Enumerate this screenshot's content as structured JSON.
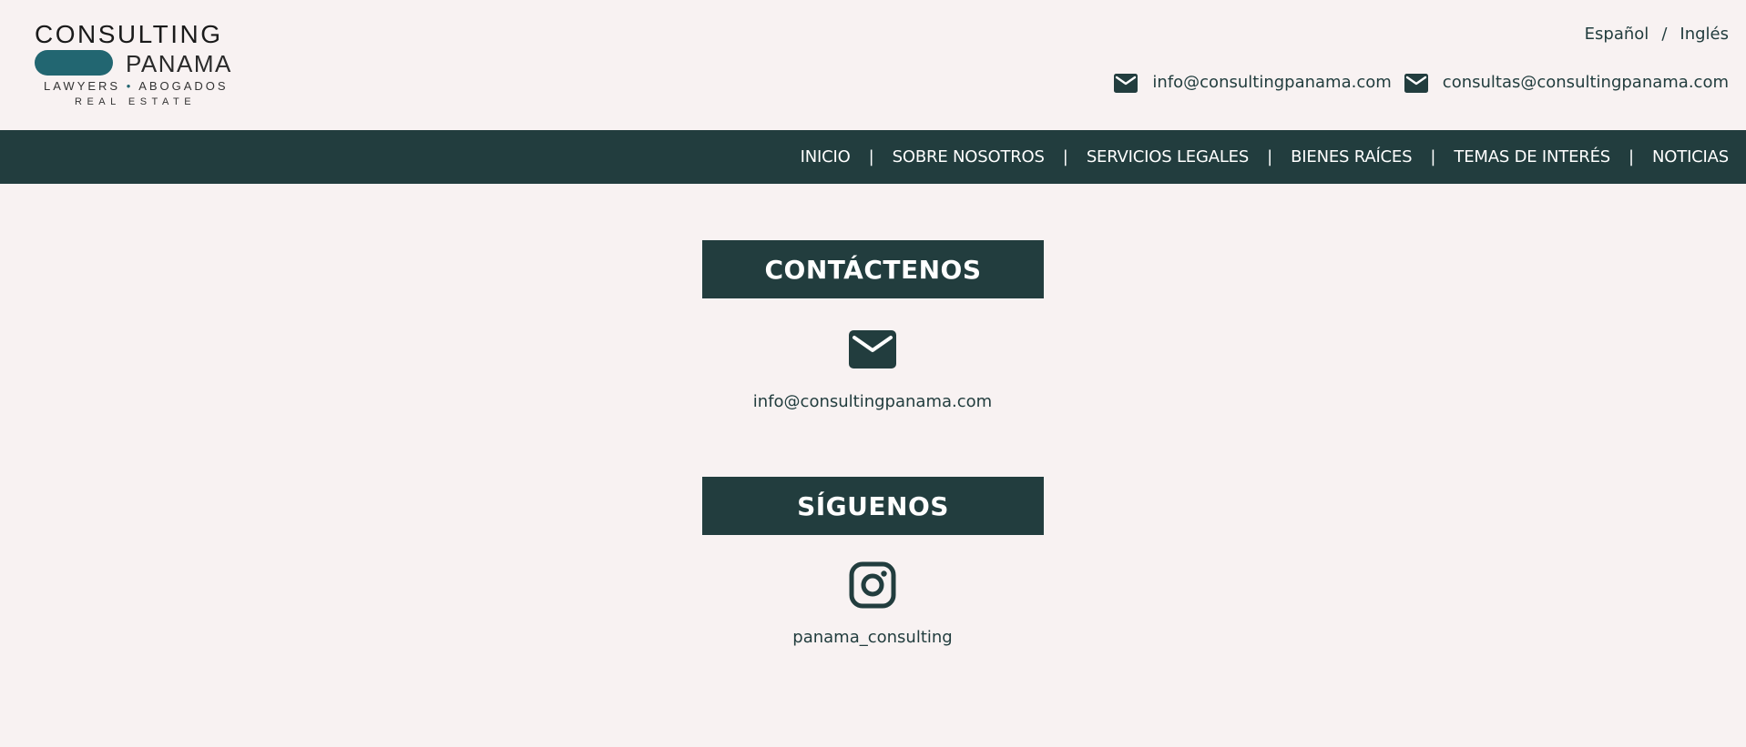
{
  "logo": {
    "line1": "CONSULTING",
    "line2": "PANAMA",
    "line3_left": "LAWYERS",
    "line3_dot": "•",
    "line3_right": "ABOGADOS",
    "line4": "REAL ESTATE",
    "pill_color": "#226671"
  },
  "language": {
    "spanish": "Español",
    "separator": "/",
    "english": "Inglés"
  },
  "header_emails": [
    {
      "icon": "envelope-icon",
      "text": "info@consultingpanama.com"
    },
    {
      "icon": "envelope-icon",
      "text": "consultas@consultingpanama.com"
    }
  ],
  "nav": {
    "separator": "|",
    "items": [
      {
        "label": "INICIO"
      },
      {
        "label": "SOBRE NOSOTROS"
      },
      {
        "label": "SERVICIOS LEGALES"
      },
      {
        "label": "BIENES RAÍCES"
      },
      {
        "label": "TEMAS DE INTERÉS"
      },
      {
        "label": "NOTICIAS"
      }
    ]
  },
  "contact": {
    "title": "CONTÁCTENOS",
    "icon": "envelope-icon",
    "email": "info@consultingpanama.com"
  },
  "follow": {
    "title": "SÍGUENOS",
    "icon": "instagram-icon",
    "handle": "panama_consulting"
  },
  "colors": {
    "background": "#f8f2f2",
    "primary_dark": "#223d3e",
    "accent": "#226671",
    "text_light": "#ffffff"
  }
}
